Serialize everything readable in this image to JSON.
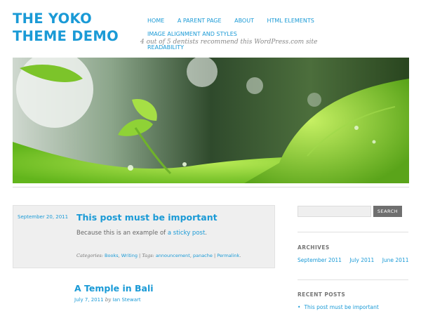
{
  "site": {
    "title": "THE YOKO THEME DEMO",
    "tagline": "4 out of 5 dentists recommend this WordPress.com site"
  },
  "nav": {
    "items": [
      "HOME",
      "A PARENT PAGE",
      "ABOUT",
      "HTML ELEMENTS",
      "IMAGE ALIGNMENT AND STYLES",
      "READABILITY"
    ]
  },
  "sticky_post": {
    "date": "September 20, 2011",
    "title": "This post must be important",
    "body_prefix": "Because this is an example of ",
    "body_link": "a sticky post",
    "body_suffix": ".",
    "categories_label": "Categories:",
    "categories": [
      "Books",
      "Writing"
    ],
    "tags_label": "Tags:",
    "tags": [
      "announcement",
      "panache"
    ],
    "permalink": "Permalink",
    "separator": "|"
  },
  "post2": {
    "title": "A Temple in Bali",
    "date": "July 7, 2011",
    "by": "by",
    "author": "Ian Stewart"
  },
  "sidebar": {
    "search_button": "SEARCH",
    "archives_title": "ARCHIVES",
    "archives": [
      "September 2011",
      "July 2011",
      "June 2011"
    ],
    "recent_title": "RECENT POSTS",
    "recent_posts": [
      "This post must be important"
    ]
  },
  "colors": {
    "accent": "#1a9ad6",
    "sticky_bg": "#efefef",
    "button_bg": "#6f6f6f"
  }
}
